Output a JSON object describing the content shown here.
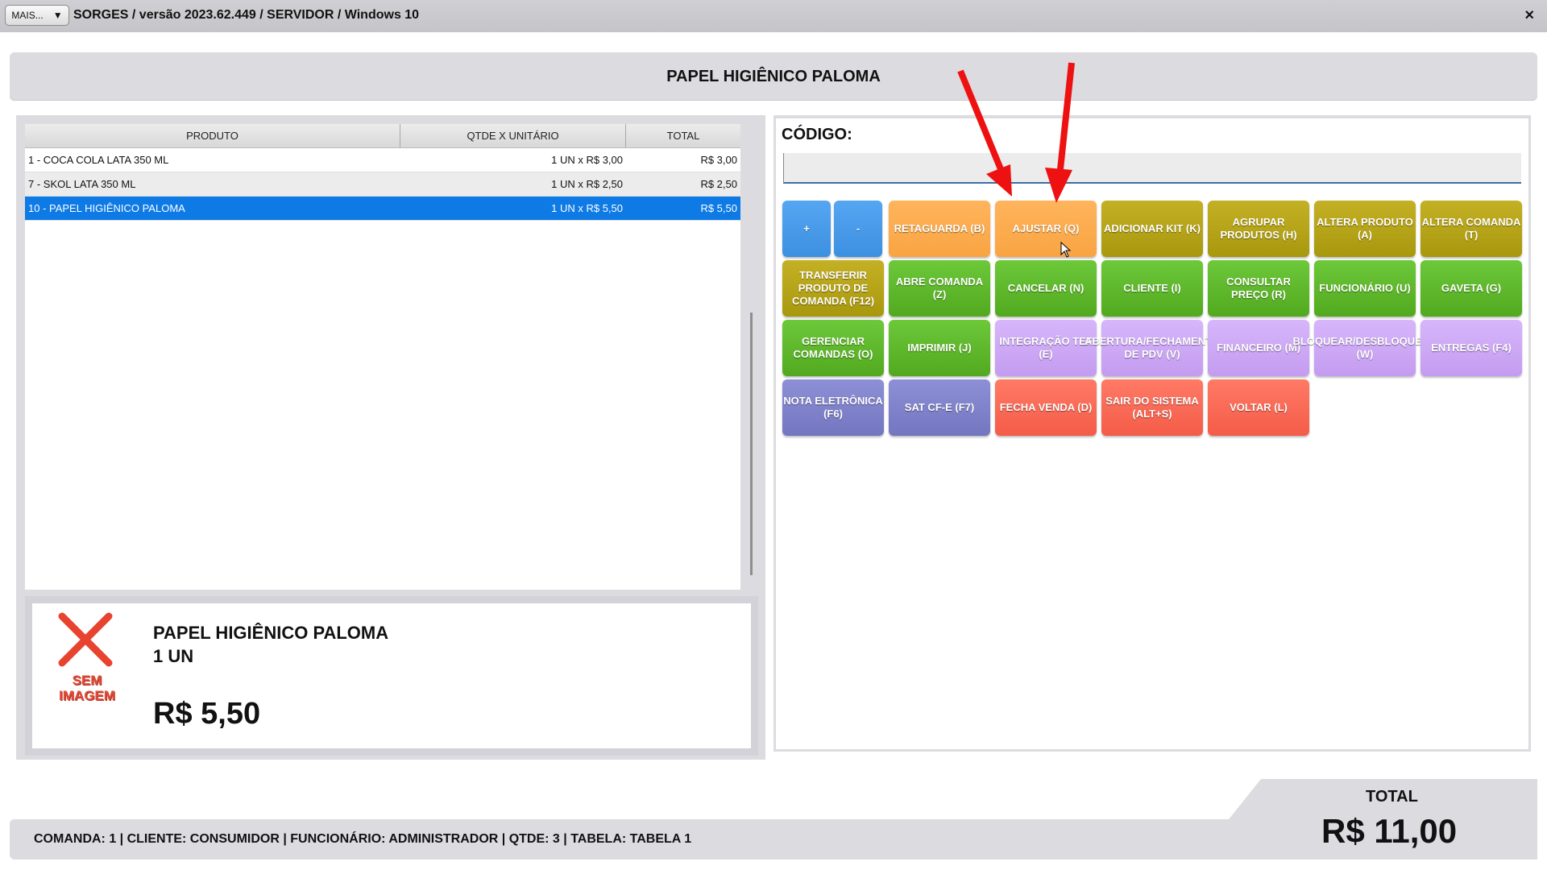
{
  "titlebar": {
    "mais_label": "MAIS...",
    "app_title": "SORGES / versão 2023.62.449 / SERVIDOR / Windows 10",
    "close_label": "×"
  },
  "header": {
    "product_name": "PAPEL HIGIÊNICO PALOMA"
  },
  "grid": {
    "columns": [
      "PRODUTO",
      "QTDE X UNITÁRIO",
      "TOTAL"
    ],
    "rows": [
      {
        "produto": "1 - COCA COLA LATA 350 ML",
        "qtde": "1 UN x R$ 3,00",
        "total": "R$ 3,00"
      },
      {
        "produto": "7 - SKOL LATA 350 ML",
        "qtde": "1 UN x R$ 2,50",
        "total": "R$ 2,50"
      },
      {
        "produto": "10 - PAPEL HIGIÊNICO PALOMA",
        "qtde": "1 UN x R$ 5,50",
        "total": "R$ 5,50"
      }
    ]
  },
  "product_card": {
    "no_image_text": "SEM IMAGEM",
    "name": "PAPEL HIGIÊNICO PALOMA",
    "qty": "1  UN",
    "price": "R$ 5,50"
  },
  "codigo": {
    "label": "CÓDIGO:",
    "value": ""
  },
  "buttons": [
    {
      "label": "+",
      "color": "#4a9be8"
    },
    {
      "label": "-",
      "color": "#4a9be8"
    },
    {
      "label": "RETAGUARDA (B)",
      "color": "#fbab4f"
    },
    {
      "label": "AJUSTAR (Q)",
      "color": "#fbab4f"
    },
    {
      "label": "ADICIONAR KIT (K)",
      "color": "#b6a418"
    },
    {
      "label": "AGRUPAR PRODUTOS (H)",
      "color": "#b6a418"
    },
    {
      "label": "ALTERA PRODUTO (A)",
      "color": "#b6a418"
    },
    {
      "label": "ALTERA COMANDA (T)",
      "color": "#b6a418"
    },
    {
      "label": "TRANSFERIR PRODUTO DE COMANDA (F12)",
      "color": "#b6a418"
    },
    {
      "label": "ABRE COMANDA (Z)",
      "color": "#5fb92c"
    },
    {
      "label": "CANCELAR (N)",
      "color": "#5fb92c"
    },
    {
      "label": "CLIENTE (I)",
      "color": "#5fb92c"
    },
    {
      "label": "CONSULTAR PREÇO (R)",
      "color": "#5fb92c"
    },
    {
      "label": "FUNCIONÁRIO (U)",
      "color": "#5fb92c"
    },
    {
      "label": "GAVETA (G)",
      "color": "#5fb92c"
    },
    {
      "label": "GERENCIAR COMANDAS (O)",
      "color": "#5fb92c"
    },
    {
      "label": "IMPRIMIR (J)",
      "color": "#5fb92c"
    },
    {
      "label": "INTEGRAÇÃO TEF (E)",
      "color": "#cda9f6"
    },
    {
      "label": "ABERTURA/FECHAMENTO DE PDV (V)",
      "color": "#cda9f6"
    },
    {
      "label": "FINANCEIRO (M)",
      "color": "#cda9f6"
    },
    {
      "label": "BLOQUEAR/DESBLOQUEAR (W)",
      "color": "#cda9f6"
    },
    {
      "label": "ENTREGAS (F4)",
      "color": "#cda9f6"
    },
    {
      "label": "NOTA ELETRÔNICA (F6)",
      "color": "#8083cb"
    },
    {
      "label": "SAT CF-E (F7)",
      "color": "#8083cb"
    },
    {
      "label": "FECHA VENDA (D)",
      "color": "#f96b57"
    },
    {
      "label": "SAIR DO SISTEMA (ALT+S)",
      "color": "#f96b57"
    },
    {
      "label": "VOLTAR (L)",
      "color": "#f96b57"
    }
  ],
  "status": {
    "text": "COMANDA: 1  |  CLIENTE: CONSUMIDOR  |  FUNCIONÁRIO: ADMINISTRADOR  |  QTDE: 3  |  TABELA: TABELA 1"
  },
  "total": {
    "label": "TOTAL",
    "value": "R$ 11,00"
  }
}
